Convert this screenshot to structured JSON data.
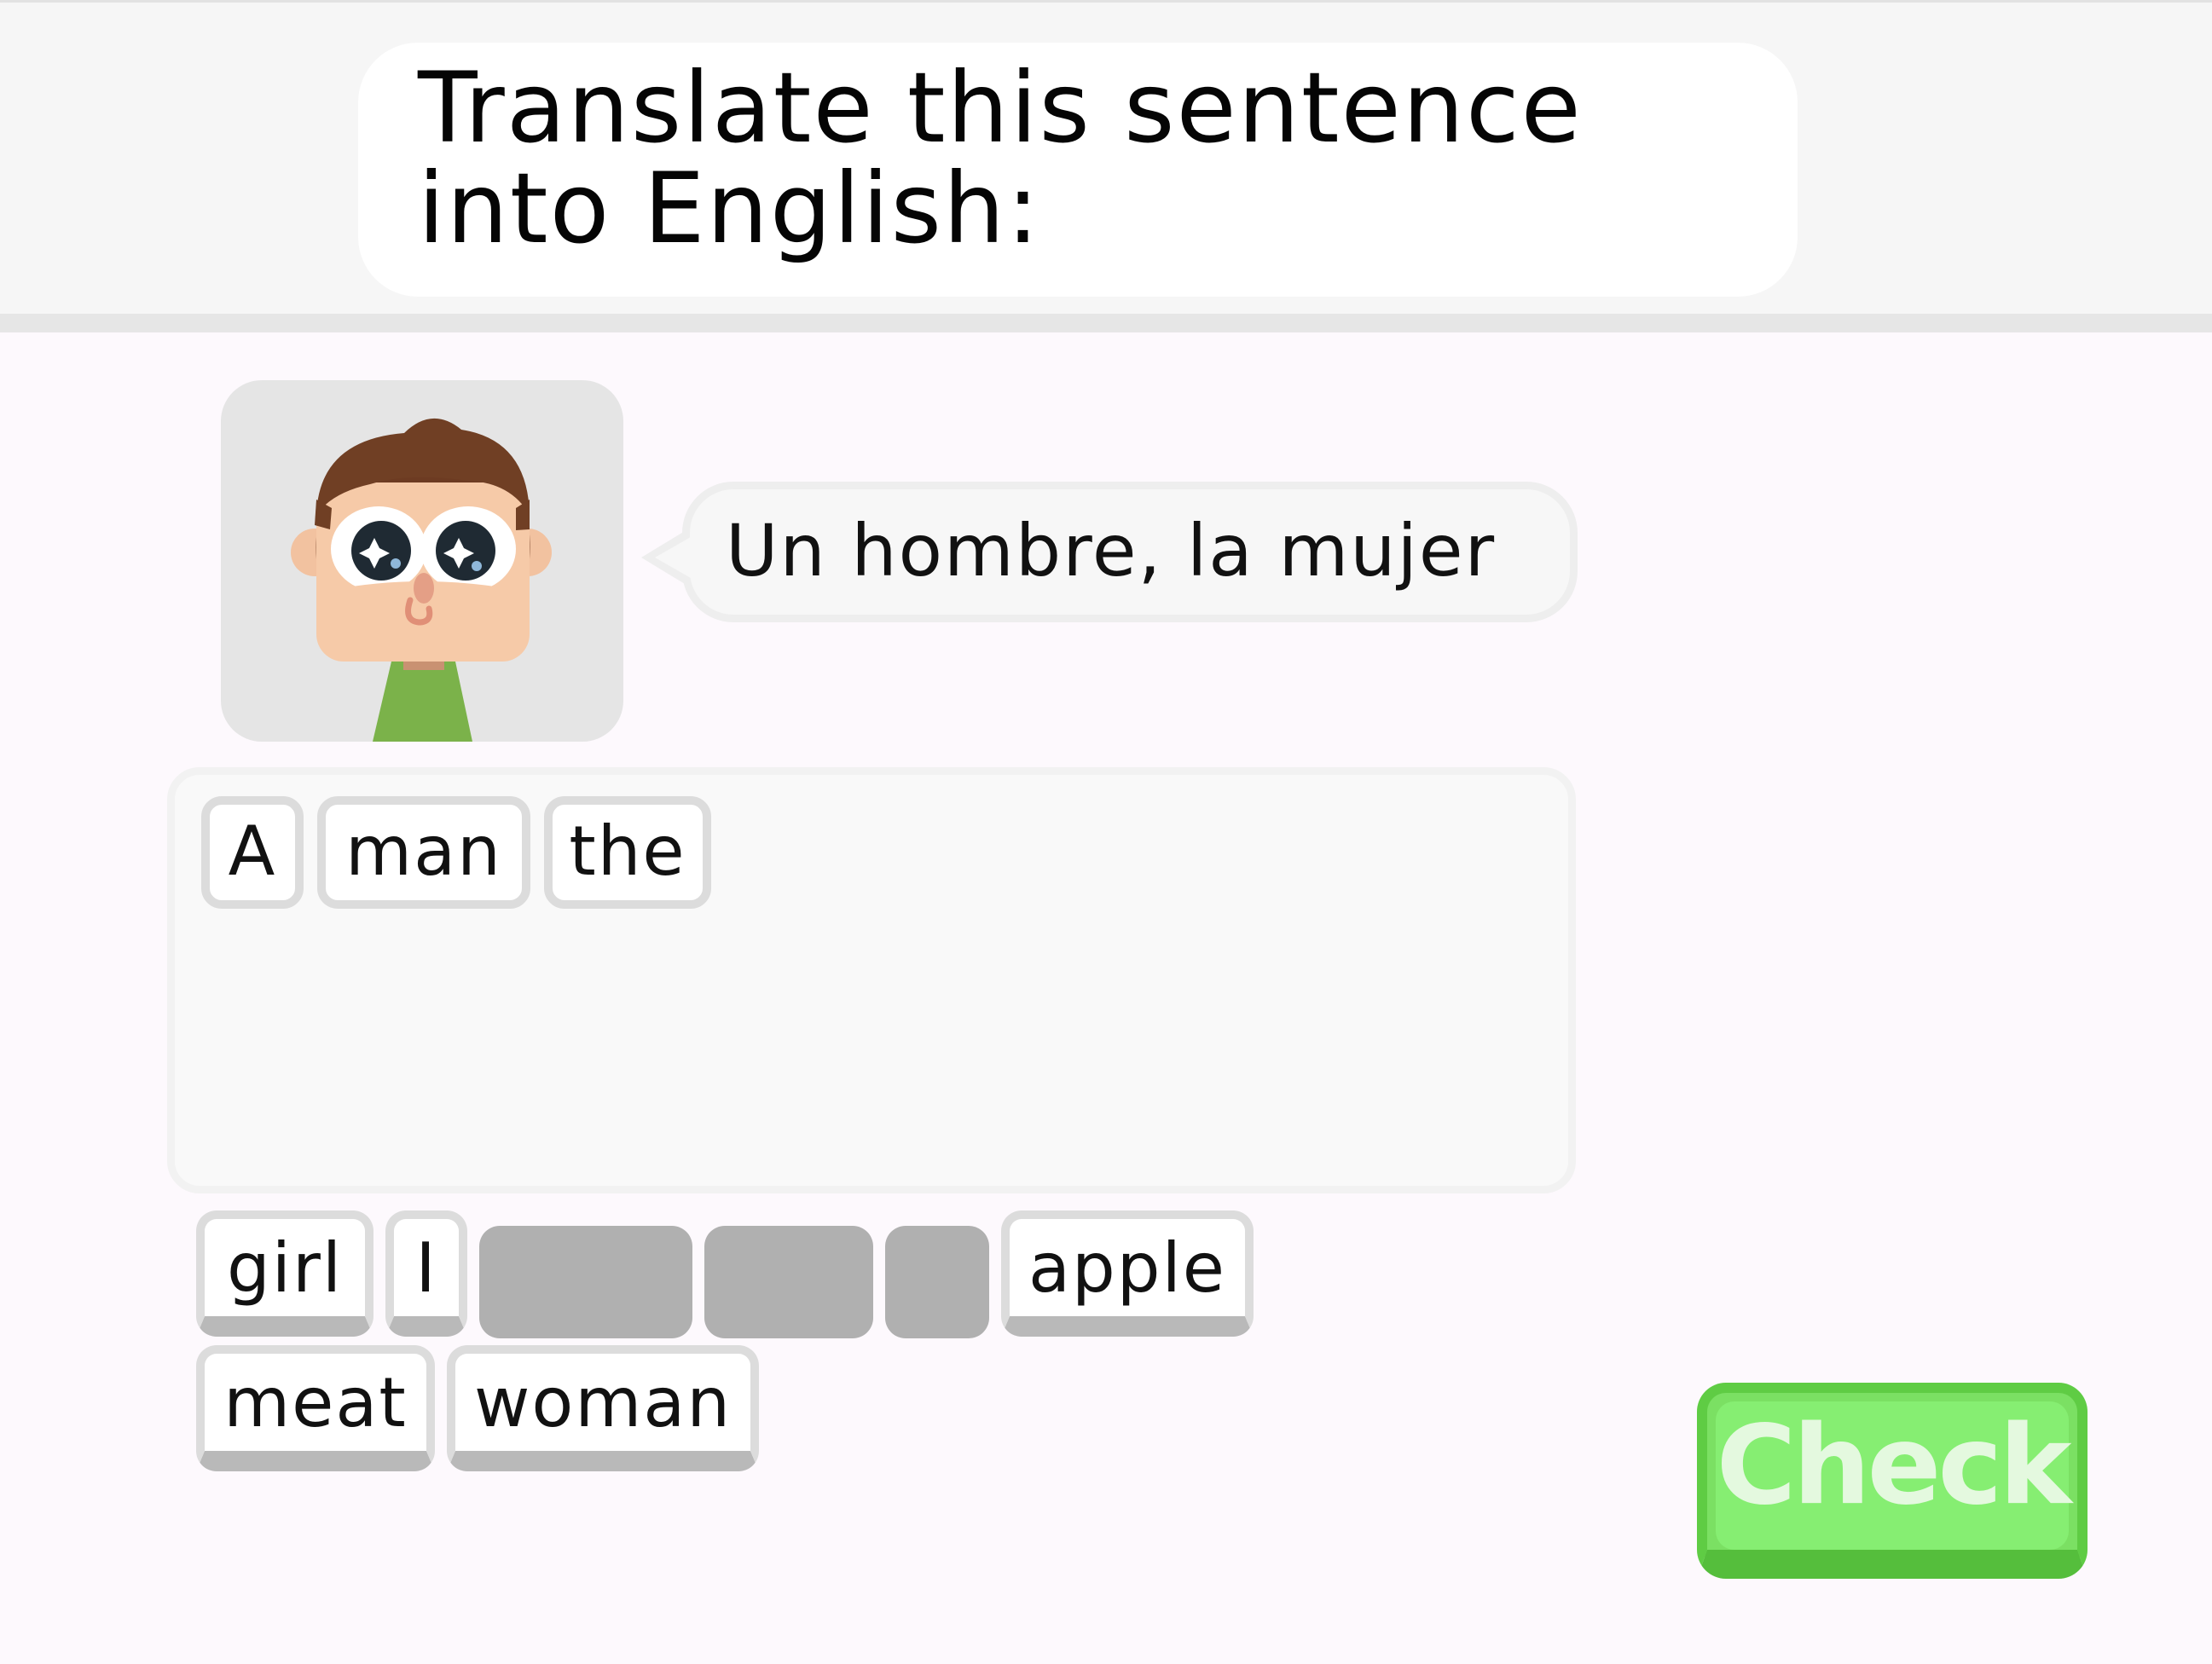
{
  "prompt": {
    "instruction": "Translate this sentence into English:"
  },
  "character": {
    "avatar_icon": "man-character-icon",
    "sentence": "Un hombre, la mujer"
  },
  "answer": {
    "placed_words": [
      "A",
      "man",
      "the"
    ]
  },
  "word_bank": {
    "row1": [
      "girl",
      "I",
      "apple"
    ],
    "row2": [
      "meat",
      "woman"
    ],
    "used_slots": 3
  },
  "actions": {
    "check_label": "Check"
  },
  "colors": {
    "check_green": "#7be063",
    "tile_border": "#dcdcdc",
    "used_slot": "#b0b0b0",
    "header_bg": "#f6f6f6"
  }
}
